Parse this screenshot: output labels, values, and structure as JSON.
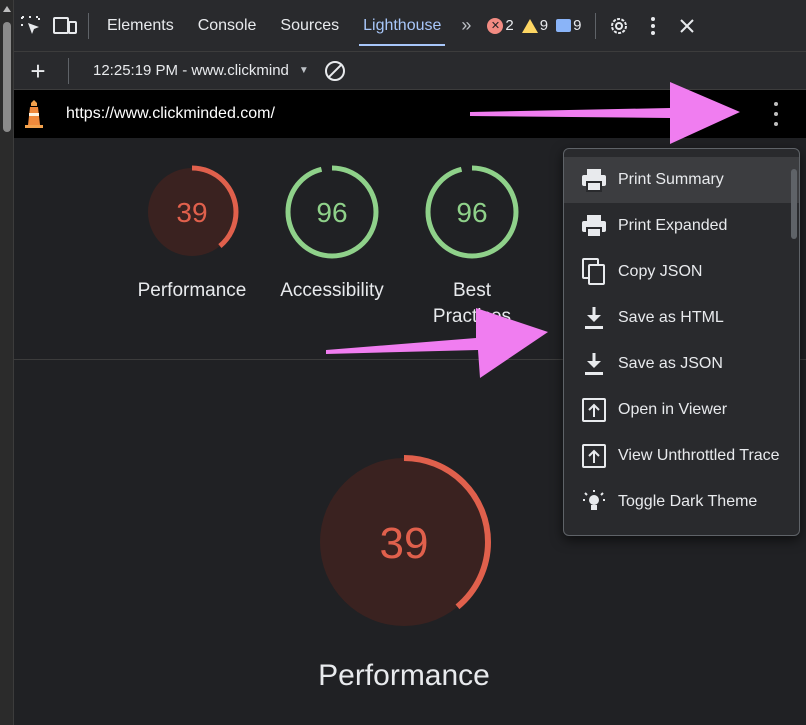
{
  "tabs": {
    "items": [
      {
        "label": "Elements"
      },
      {
        "label": "Console"
      },
      {
        "label": "Sources"
      },
      {
        "label": "Lighthouse"
      }
    ],
    "more": "»",
    "errors_count": "2",
    "warnings_count": "9",
    "messages_count": "9"
  },
  "toolbar": {
    "add": "+",
    "report_select": "12:25:19 PM - www.clickmind"
  },
  "urlbar": {
    "url": "https://www.clickminded.com/"
  },
  "gauges": [
    {
      "label": "Performance",
      "score": "39",
      "value": 0.39,
      "color": "#e0604c",
      "fill": "#3a2220"
    },
    {
      "label": "Accessibility",
      "score": "96",
      "value": 0.96,
      "color": "#8fd18a",
      "fill": "#202124"
    },
    {
      "label": "Best\nPractices",
      "label_line1": "Best",
      "label_line2": "Practices",
      "score": "96",
      "value": 0.96,
      "color": "#8fd18a",
      "fill": "#202124"
    }
  ],
  "big_gauge": {
    "label": "Performance",
    "score": "39",
    "value": 0.39,
    "color": "#e0604c"
  },
  "menu": {
    "items": [
      {
        "label": "Print Summary",
        "icon": "printer-icon"
      },
      {
        "label": "Print Expanded",
        "icon": "printer-icon"
      },
      {
        "label": "Copy JSON",
        "icon": "copy-icon"
      },
      {
        "label": "Save as HTML",
        "icon": "download-icon"
      },
      {
        "label": "Save as JSON",
        "icon": "download-icon"
      },
      {
        "label": "Open in Viewer",
        "icon": "open-in-icon"
      },
      {
        "label": "View Unthrottled Trace",
        "icon": "open-in-icon"
      },
      {
        "label": "Toggle Dark Theme",
        "icon": "lightbulb-icon"
      }
    ]
  },
  "colors": {
    "active_tab": "#a8c7fa",
    "annotation_arrow": "#f07df0",
    "poor": "#e0604c",
    "good": "#8fd18a"
  }
}
